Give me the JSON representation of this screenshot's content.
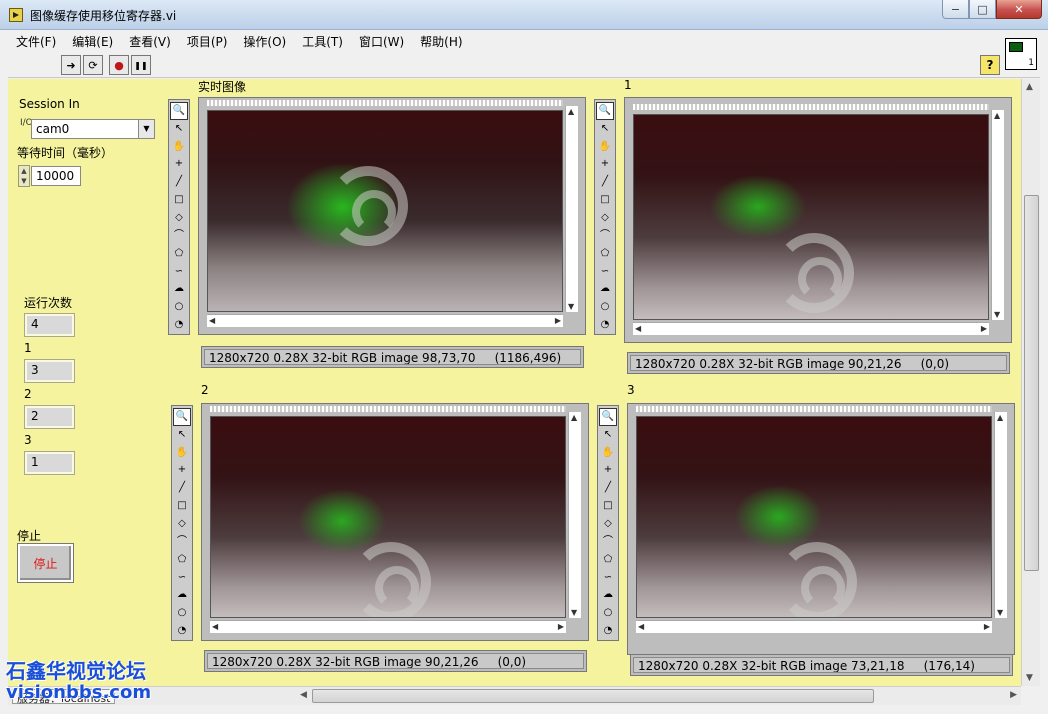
{
  "window": {
    "title": "图像缓存使用移位寄存器.vi",
    "min": "−",
    "max": "□",
    "close": "✕"
  },
  "menu": [
    "文件(F)",
    "编辑(E)",
    "查看(V)",
    "项目(P)",
    "操作(O)",
    "工具(T)",
    "窗口(W)",
    "帮助(H)"
  ],
  "toolbar": {
    "run": "➜",
    "run_continuous": "⟳",
    "abort": "●",
    "pause": "❚❚",
    "help": "?"
  },
  "vi_icon_number": "1",
  "controls": {
    "session_label": "Session In",
    "session_value": "cam0",
    "session_io_glyph": "I/O",
    "wait_label": "等待时间（毫秒）",
    "wait_value": "10000",
    "run_count_label": "运行次数",
    "run_count_value": "4",
    "ind1_label": "1",
    "ind1_value": "3",
    "ind2_label": "2",
    "ind2_value": "2",
    "ind3_label": "3",
    "ind3_value": "1",
    "stop_label": "停止",
    "stop_button": "停止"
  },
  "displays": [
    {
      "label": "实时图像",
      "info": "1280x720 0.28X 32-bit RGB image 98,73,70     (1186,496)"
    },
    {
      "label": "1",
      "info": "1280x720 0.28X 32-bit RGB image 90,21,26     (0,0)"
    },
    {
      "label": "2",
      "info": "1280x720 0.28X 32-bit RGB image 90,21,26     (0,0)"
    },
    {
      "label": "3",
      "info": "1280x720 0.28X 32-bit RGB image 73,21,18     (176,14)"
    }
  ],
  "status": {
    "target": "服务器：localhost"
  },
  "watermark": {
    "line1": "石鑫华视觉论坛",
    "line2": "visionbbs.com"
  },
  "palette_tools": [
    "zoom-tool",
    "pointer-tool",
    "pan-tool",
    "point-tool",
    "line-tool",
    "rectangle-tool",
    "rotated-rectangle-tool",
    "polyline-tool",
    "polygon-tool",
    "freehand-line-tool",
    "freehand-region-tool",
    "oval-tool",
    "annulus-tool"
  ]
}
